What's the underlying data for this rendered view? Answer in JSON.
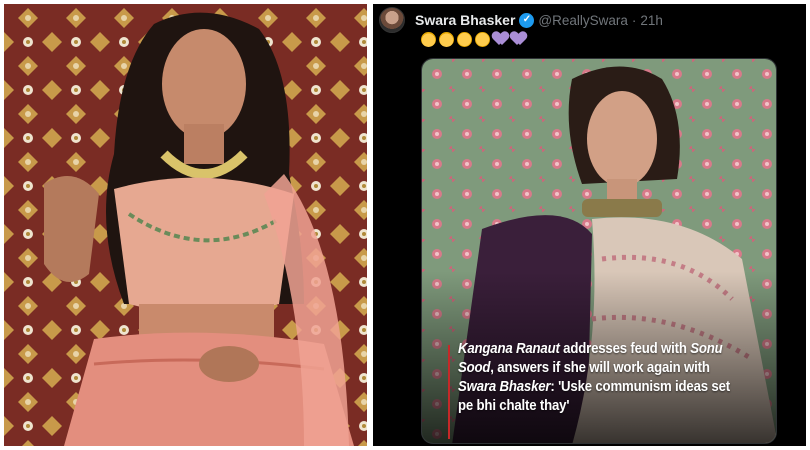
{
  "tweet": {
    "author_name": "Swara Bhasker",
    "author_handle": "@ReallySwara",
    "separator": "·",
    "time": "21h",
    "emojis": [
      "nerd-face-icon",
      "nerd-face-icon",
      "laughing-face-icon",
      "laughing-face-icon",
      "purple-heart-icon",
      "purple-heart-icon"
    ],
    "caption": {
      "part1_name": "Kangana Ranaut",
      "part1_text": " addresses feud with ",
      "part2_name": "Sonu Sood",
      "part2_text": ", answers if she will work again with ",
      "part3_name": "Swara Bhasker",
      "part3_text": ": 'Uske communism ideas set pe bhi chalte thay'"
    }
  },
  "colors": {
    "background": "#000000",
    "name_text": "#e7e9ea",
    "meta_text": "#71767b",
    "verified": "#1d9bf0",
    "heart": "#aa8ed6",
    "caption_accent": "#c62828"
  }
}
